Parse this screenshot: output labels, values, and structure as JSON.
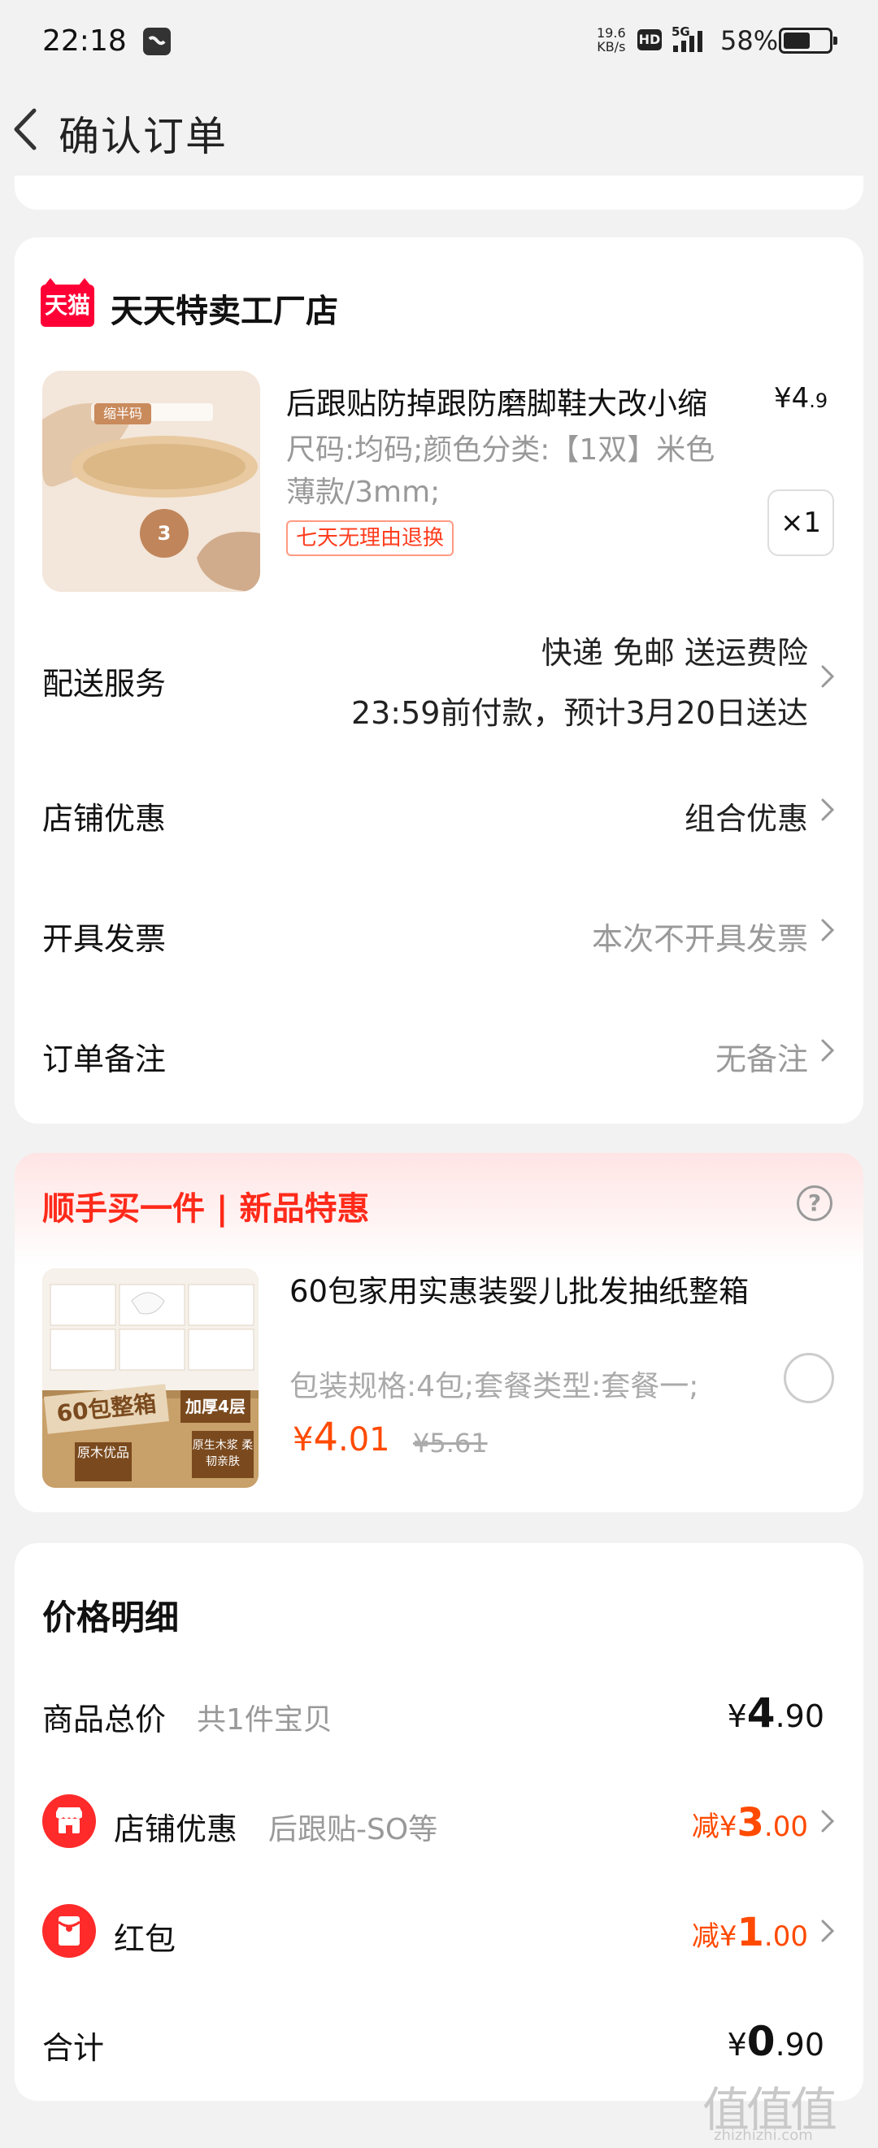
{
  "status_bar": {
    "time": "22:18",
    "speed_value": "19.6",
    "speed_unit": "KB/s",
    "hd": "HD",
    "network": "5G",
    "battery": "58%"
  },
  "header": {
    "title": "确认订单",
    "back_icon": "chevron-left-icon"
  },
  "shop": {
    "logo_text": "天猫",
    "name": "天天特卖工厂店",
    "product": {
      "title": "后跟贴防掉跟防磨脚鞋大改小缩",
      "price_main": "¥4",
      "price_decimal": ".9",
      "sku_line1": "尺码:均码;颜色分类:【1双】米色",
      "sku_line2": "薄款/3mm;",
      "tag": "七天无理由退换",
      "quantity": "×1",
      "image_badge": "缩半码",
      "image_circle": "3"
    },
    "rows": [
      {
        "label": "配送服务",
        "value_line1": "快递 免邮 送运费险",
        "value_line2": "23:59前付款，预计3月20日送达"
      },
      {
        "label": "店铺优惠",
        "value": "组合优惠"
      },
      {
        "label": "开具发票",
        "value": "本次不开具发票"
      },
      {
        "label": "订单备注",
        "value": "无备注"
      }
    ]
  },
  "upsell": {
    "title": "顺手买一件 | 新品特惠",
    "help_icon": "?",
    "product": {
      "title": "60包家用实惠装婴儿批发抽纸整箱",
      "sku": "包装规格:4包;套餐类型:套餐一;",
      "price_symbol": "¥",
      "price_main": "4",
      "price_decimal": ".01",
      "orig_price": "¥5.61",
      "image_text_a": "60包整箱",
      "image_text_b": "加厚4层",
      "image_text_c": "原木优品",
      "image_text_d": "原生木浆 柔韧亲肤"
    }
  },
  "price_detail": {
    "title": "价格明细",
    "items": [
      {
        "label": "商品总价",
        "sub": "共1件宝贝",
        "prefix": "¥",
        "main": "4",
        "decimal": ".90"
      },
      {
        "label": "店铺优惠",
        "sub": "后跟贴-SO等",
        "prefix": "减¥",
        "main": "3",
        "decimal": ".00",
        "icon": "store-icon"
      },
      {
        "label": "红包",
        "sub": "",
        "prefix": "减¥",
        "main": "1",
        "decimal": ".00",
        "icon": "red-packet-icon"
      }
    ],
    "total_label": "合计",
    "total_prefix": "¥",
    "total_main": "0",
    "total_decimal": ".90"
  },
  "watermark": {
    "text": "值值值",
    "url": "zhizhizhi.com"
  },
  "colors": {
    "accent_red": "#ff2a1a",
    "price_orange": "#ff4a00",
    "tmall_red": "#ff0036"
  }
}
